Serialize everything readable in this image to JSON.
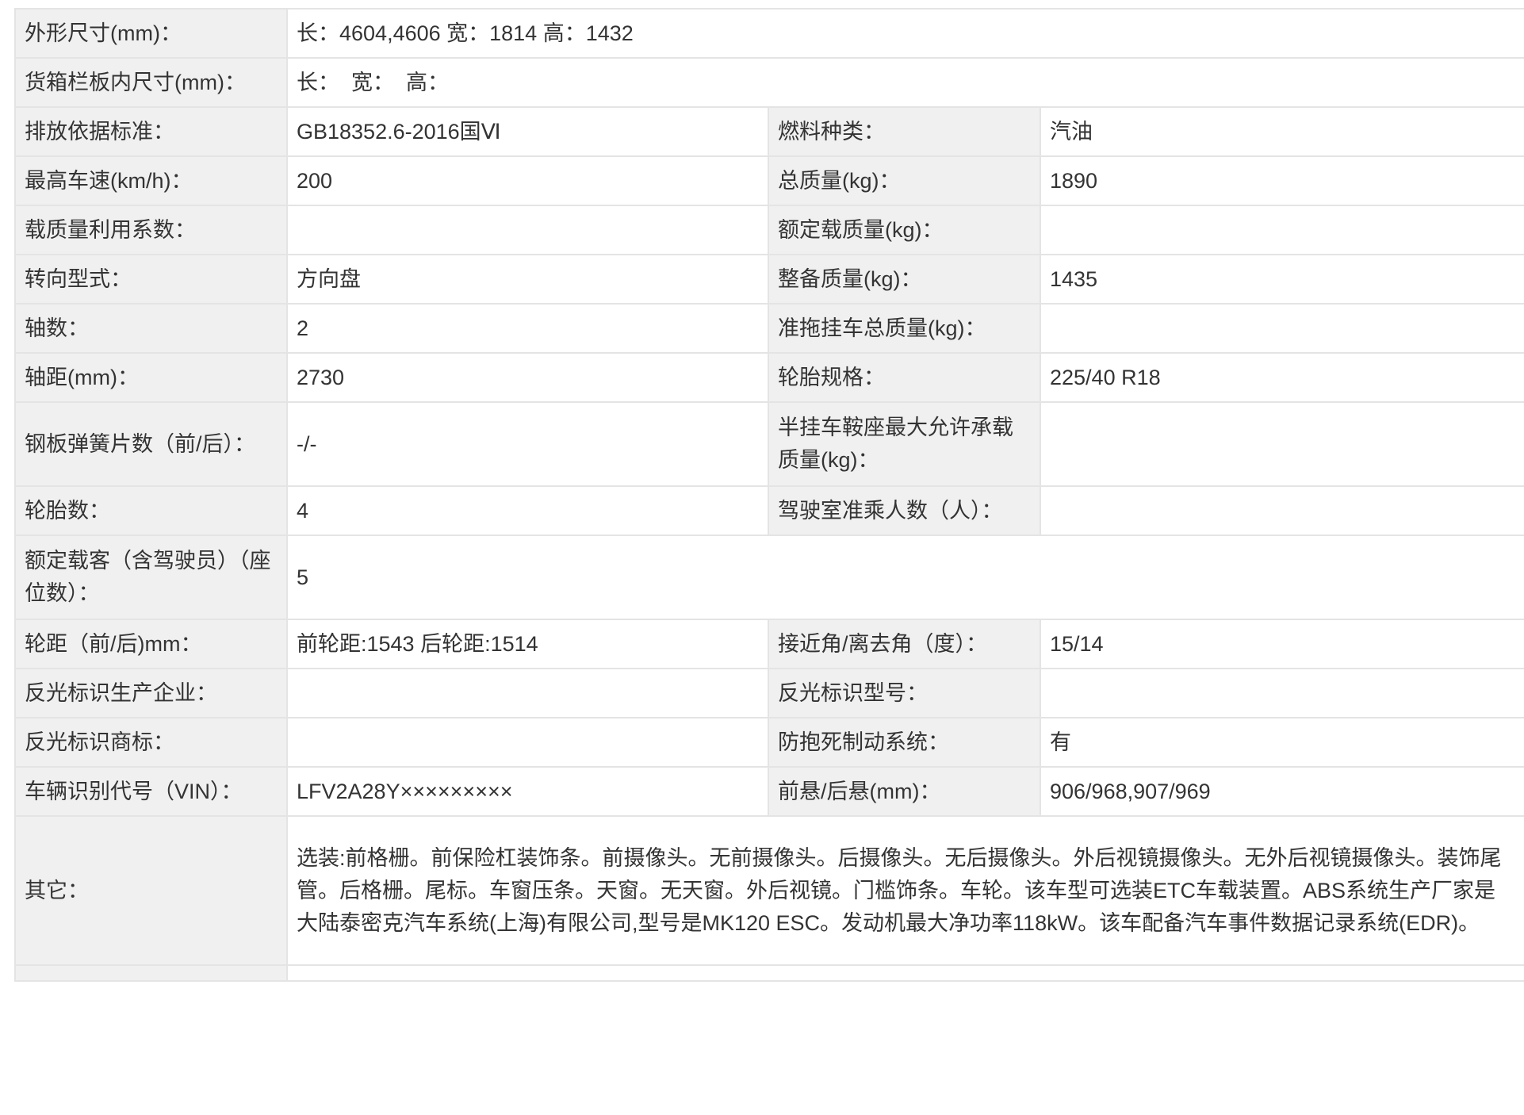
{
  "rows": {
    "dimensions": {
      "label": "外形尺寸(mm)：",
      "value": "长：4604,4606 宽：1814 高：1432"
    },
    "cargo_box": {
      "label": "货箱栏板内尺寸(mm)：",
      "value": "长：  宽：  高："
    },
    "emission": {
      "label": "排放依据标准：",
      "value": "GB18352.6-2016国Ⅵ",
      "label2": "燃料种类：",
      "value2": "汽油"
    },
    "top_speed": {
      "label": "最高车速(km/h)：",
      "value": "200",
      "label2": "总质量(kg)：",
      "value2": "1890"
    },
    "load_coefficient": {
      "label": "载质量利用系数：",
      "value": "",
      "label2": "额定载质量(kg)：",
      "value2": ""
    },
    "steering": {
      "label": "转向型式：",
      "value": "方向盘",
      "label2": "整备质量(kg)：",
      "value2": "1435"
    },
    "axles": {
      "label": "轴数：",
      "value": "2",
      "label2": "准拖挂车总质量(kg)：",
      "value2": ""
    },
    "wheelbase": {
      "label": "轴距(mm)：",
      "value": "2730",
      "label2": "轮胎规格：",
      "value2": "225/40 R18"
    },
    "leaf_springs": {
      "label": "钢板弹簧片数（前/后）：",
      "value": "-/-",
      "label2": "半挂车鞍座最大允许承载质量(kg)：",
      "value2": ""
    },
    "tire_count": {
      "label": "轮胎数：",
      "value": "4",
      "label2": "驾驶室准乘人数（人）：",
      "value2": ""
    },
    "seats": {
      "label": "额定载客（含驾驶员）（座位数）：",
      "value": "5"
    },
    "track": {
      "label": "轮距（前/后)mm：",
      "value": "前轮距:1543 后轮距:1514",
      "label2": "接近角/离去角（度）：",
      "value2": "15/14"
    },
    "reflector_maker": {
      "label": "反光标识生产企业：",
      "value": "",
      "label2": "反光标识型号：",
      "value2": ""
    },
    "reflector_brand": {
      "label": "反光标识商标：",
      "value": "",
      "label2": "防抱死制动系统：",
      "value2": "有"
    },
    "vin": {
      "label": "车辆识别代号（VIN）：",
      "value": "LFV2A28Y×××××××××",
      "label2": "前悬/后悬(mm)：",
      "value2": "906/968,907/969"
    },
    "other": {
      "label": "其它：",
      "value": "选装:前格栅。前保险杠装饰条。前摄像头。无前摄像头。后摄像头。无后摄像头。外后视镜摄像头。无外后视镜摄像头。装饰尾管。后格栅。尾标。车窗压条。天窗。无天窗。外后视镜。门槛饰条。车轮。该车型可选装ETC车载装置。ABS系统生产厂家是大陆泰密克汽车系统(上海)有限公司,型号是MK120 ESC。发动机最大净功率118kW。该车配备汽车事件数据记录系统(EDR)。"
    }
  },
  "colors": {
    "label_bg": "#f0f0f0",
    "value_bg": "#ffffff",
    "border": "#e4e4e4",
    "text": "#333333"
  }
}
